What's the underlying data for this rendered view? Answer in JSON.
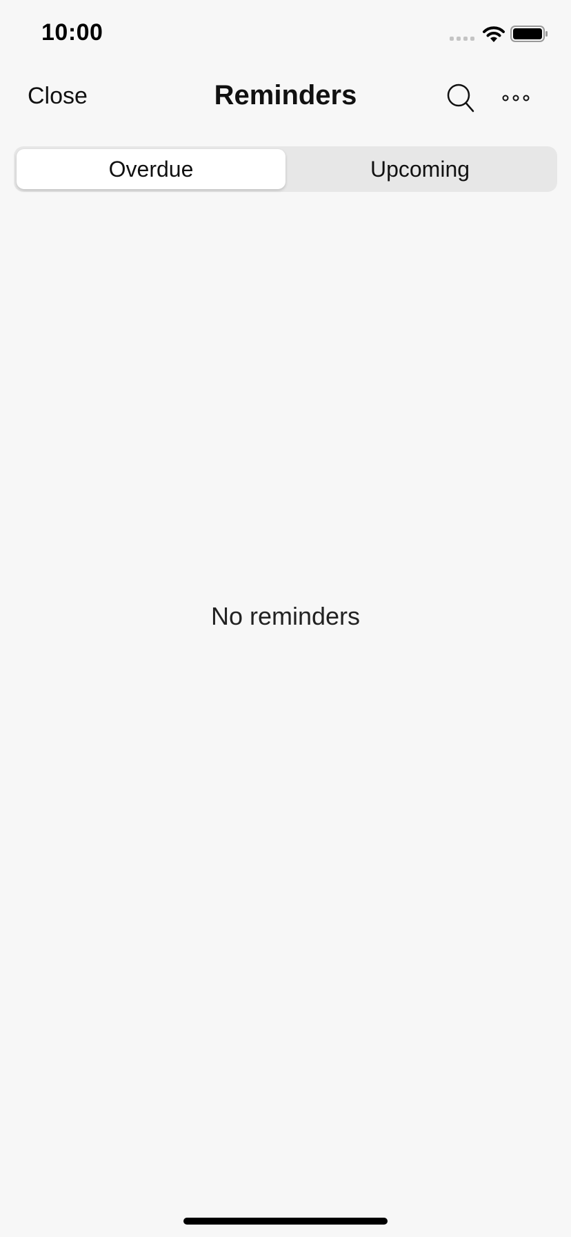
{
  "status_bar": {
    "time": "10:00",
    "icons": [
      "cellular-signal-icon",
      "wifi-icon",
      "battery-icon"
    ]
  },
  "nav": {
    "close_label": "Close",
    "title": "Reminders",
    "search_icon": "search-icon",
    "more_icon": "more-horizontal-icon"
  },
  "tabs": [
    {
      "label": "Overdue",
      "selected": true
    },
    {
      "label": "Upcoming",
      "selected": false
    }
  ],
  "empty_state": {
    "message": "No reminders"
  },
  "colors": {
    "background": "#f7f7f7",
    "segment_track": "#e7e7e7",
    "segment_active": "#ffffff",
    "text": "#111111"
  }
}
